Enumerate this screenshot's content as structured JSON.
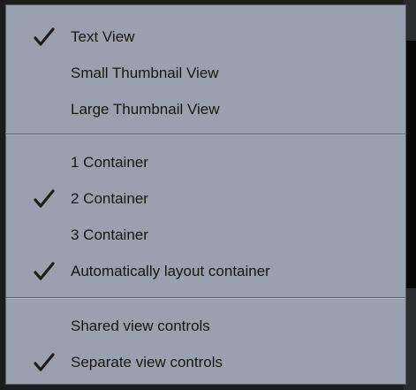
{
  "menu": {
    "groups": [
      {
        "items": [
          {
            "label": "Text View",
            "checked": true
          },
          {
            "label": "Small Thumbnail View",
            "checked": false
          },
          {
            "label": "Large Thumbnail View",
            "checked": false
          }
        ]
      },
      {
        "items": [
          {
            "label": "1 Container",
            "checked": false
          },
          {
            "label": "2 Container",
            "checked": true
          },
          {
            "label": "3 Container",
            "checked": false
          },
          {
            "label": "Automatically layout container",
            "checked": true
          }
        ]
      },
      {
        "items": [
          {
            "label": "Shared view controls",
            "checked": false
          },
          {
            "label": "Separate view controls",
            "checked": true
          }
        ]
      }
    ]
  },
  "icons": {
    "check": "checkmark-icon"
  },
  "colors": {
    "menu_background": "#9aa0ad",
    "menu_text": "#161616",
    "separator": "#5d636e",
    "page_background": "#1b1c1e"
  }
}
